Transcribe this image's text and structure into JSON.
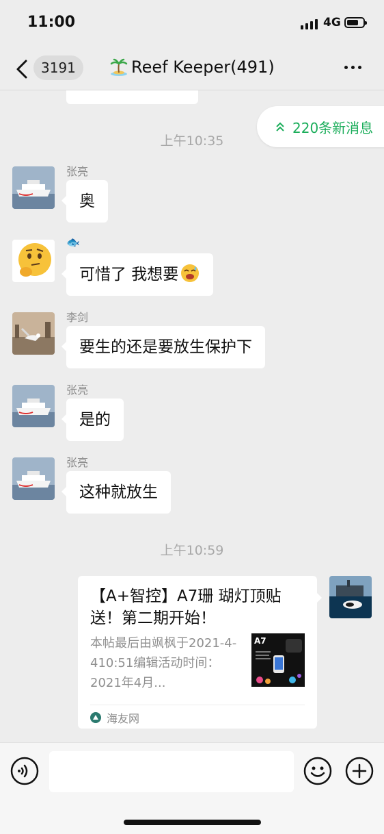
{
  "status_bar": {
    "time": "11:00",
    "network": "4G"
  },
  "header": {
    "back_count": "3191",
    "title": "Reef Keeper(491)"
  },
  "new_messages": {
    "label": "220条新消息"
  },
  "timestamps": [
    "上午10:35",
    "上午10:59"
  ],
  "messages": [
    {
      "sender": "张亮",
      "text": "奥"
    },
    {
      "sender": "🐟",
      "text": "可惜了 我想要"
    },
    {
      "sender": "李剑",
      "text": "要生的还是要放生保护下"
    },
    {
      "sender": "张亮",
      "text": "是的"
    },
    {
      "sender": "张亮",
      "text": "这种就放生"
    }
  ],
  "link_card": {
    "title": "【A+智控】A7珊 瑚灯顶贴送！第二期开始！",
    "description": "本帖最后由飒枫于2021-4-410:51编辑活动时间：2021年4月...",
    "thumbnail_label": "A7",
    "source": "海友网"
  },
  "input": {
    "placeholder": ""
  },
  "colors": {
    "accent_green": "#1aad5a",
    "background": "#ededed",
    "bubble": "#ffffff"
  }
}
